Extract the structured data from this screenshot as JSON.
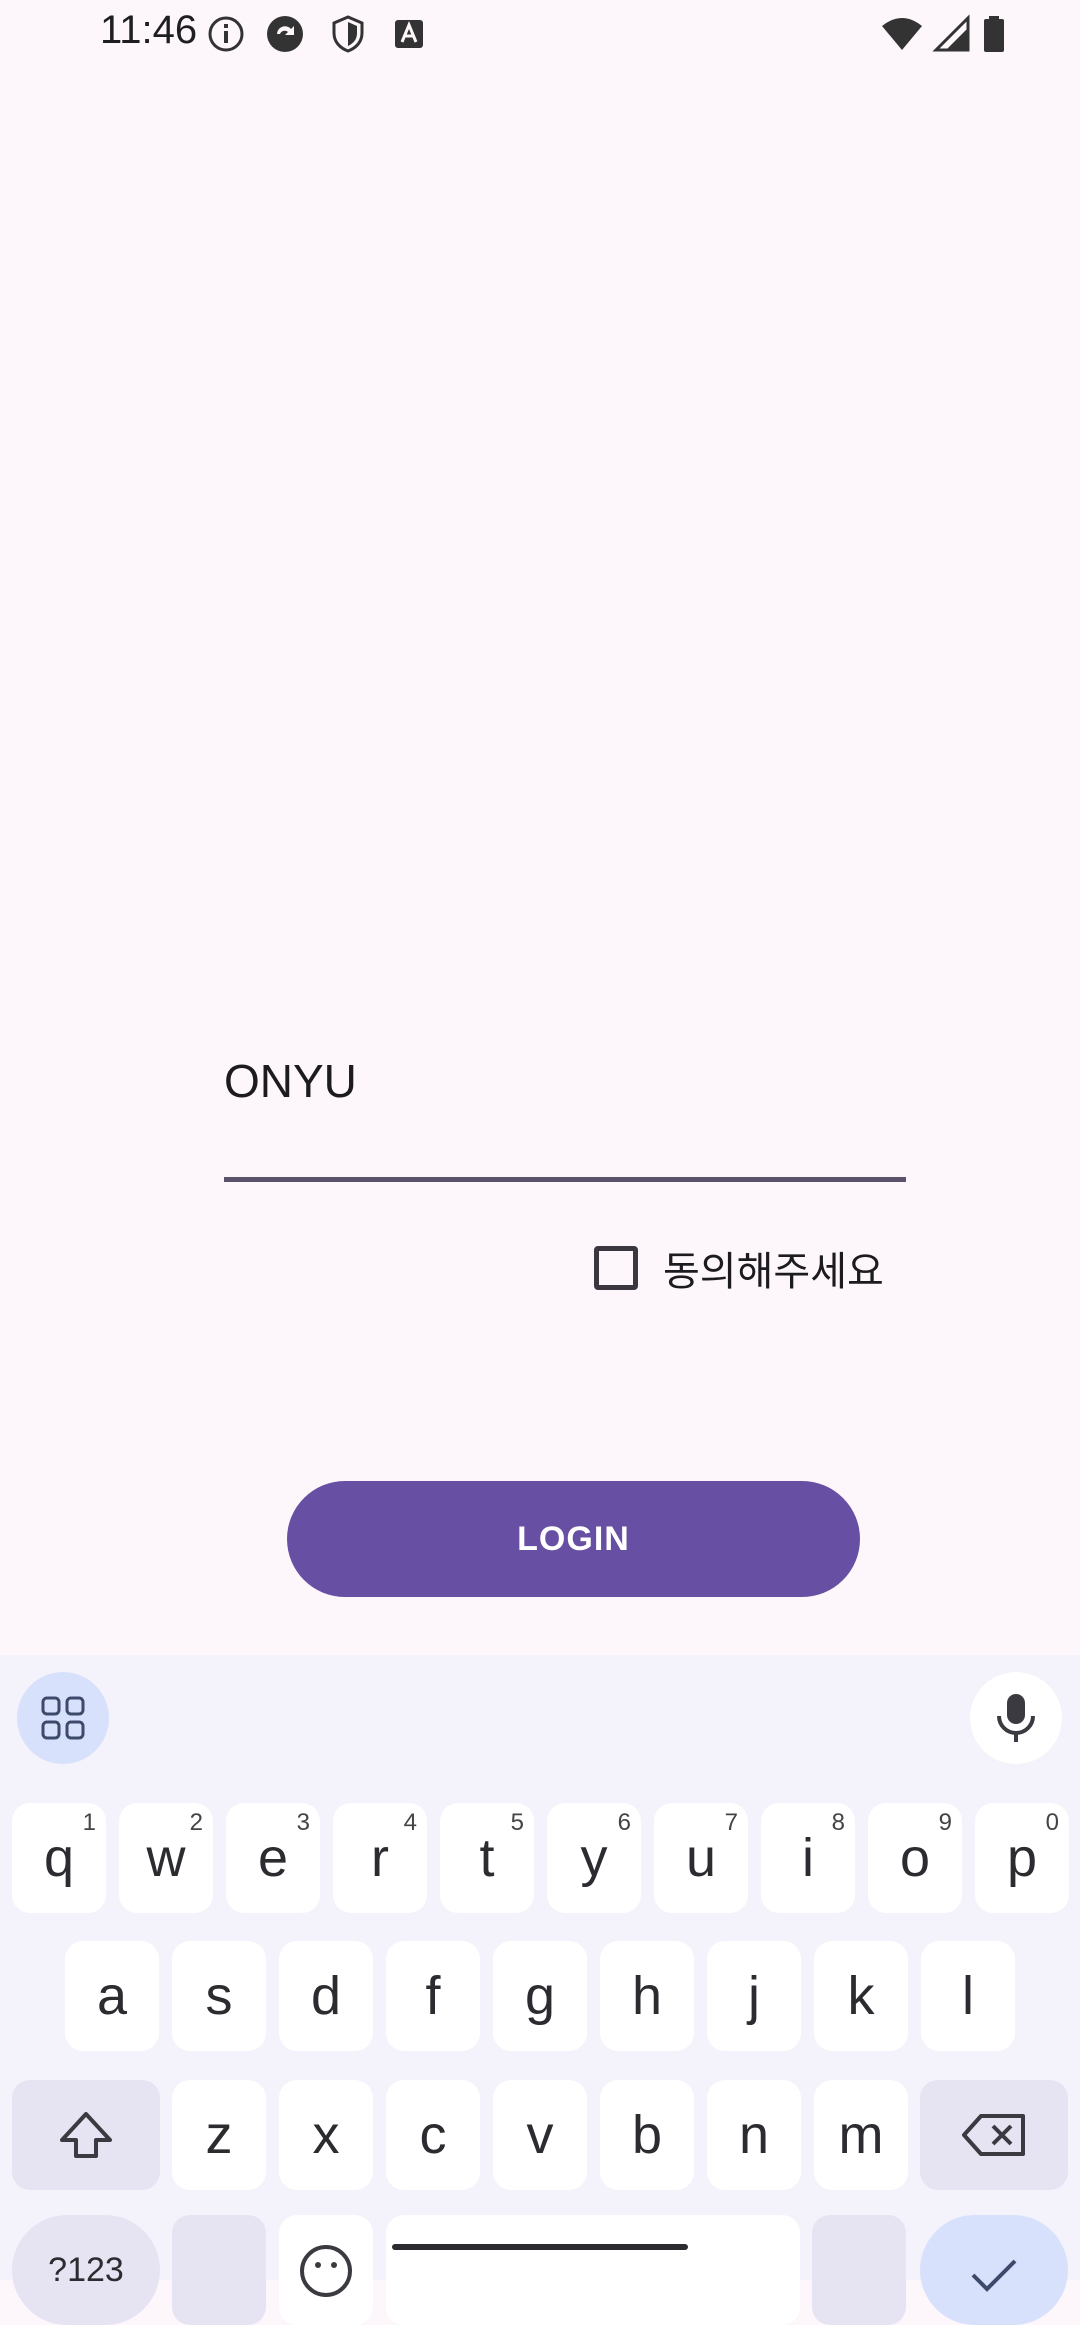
{
  "status_bar": {
    "time": "11:46",
    "left_icons": [
      "info-icon",
      "sync-icon",
      "shield-icon",
      "keyboard-a-icon"
    ],
    "right_icons": [
      "wifi-icon",
      "signal-icon",
      "battery-icon"
    ]
  },
  "form": {
    "name_value": "ONYU",
    "agree_label": "동의해주세요",
    "agree_checked": false,
    "login_label": "LOGIN"
  },
  "colors": {
    "primary": "#674fa3",
    "background": "#fdf7fb",
    "keyboard_bg": "#f4f2fa"
  },
  "keyboard": {
    "row1": [
      {
        "k": "q",
        "h": "1"
      },
      {
        "k": "w",
        "h": "2"
      },
      {
        "k": "e",
        "h": "3"
      },
      {
        "k": "r",
        "h": "4"
      },
      {
        "k": "t",
        "h": "5"
      },
      {
        "k": "y",
        "h": "6"
      },
      {
        "k": "u",
        "h": "7"
      },
      {
        "k": "i",
        "h": "8"
      },
      {
        "k": "o",
        "h": "9"
      },
      {
        "k": "p",
        "h": "0"
      }
    ],
    "row2": [
      "a",
      "s",
      "d",
      "f",
      "g",
      "h",
      "j",
      "k",
      "l"
    ],
    "row3": [
      "z",
      "x",
      "c",
      "v",
      "b",
      "n",
      "m"
    ],
    "symbols_label": "?123"
  }
}
